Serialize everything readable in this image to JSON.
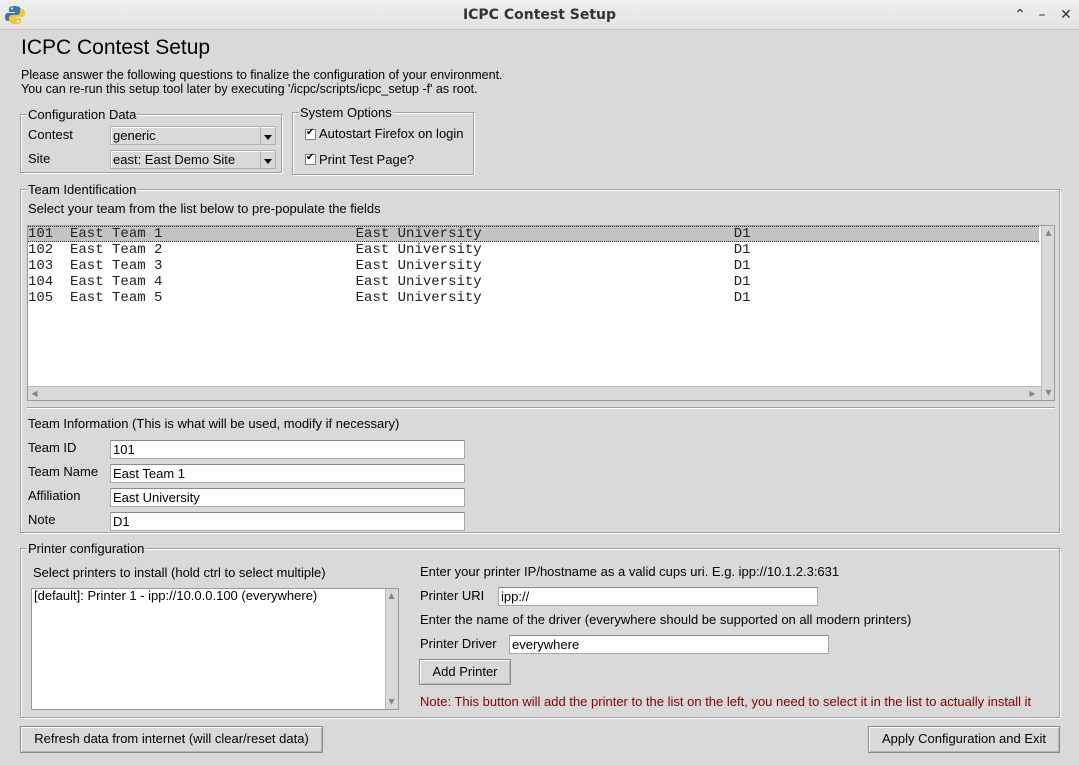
{
  "window": {
    "title": "ICPC Contest Setup",
    "controls": {
      "maximize": "⌃",
      "minimize": "–",
      "close": "✕"
    }
  },
  "heading": "ICPC Contest Setup",
  "intro": {
    "line1": "Please answer the following questions to finalize the configuration of your environment.",
    "line2": "You can re-run this setup tool later by executing '/icpc/scripts/icpc_setup -f' as root."
  },
  "config": {
    "legend": "Configuration Data",
    "contest_label": "Contest",
    "contest_value": "generic",
    "site_label": "Site",
    "site_value": "east: East Demo Site"
  },
  "system": {
    "legend": "System Options",
    "autostart_label": "Autostart Firefox on login",
    "autostart_checked": true,
    "print_test_label": "Print Test Page?",
    "print_test_checked": true
  },
  "team_identification": {
    "legend": "Team Identification",
    "instructions": "Select your team from the list below to pre-populate the fields",
    "selected_index": 0,
    "teams": [
      {
        "id": "101",
        "name": "East Team 1",
        "affiliation": "East University",
        "note": "D1"
      },
      {
        "id": "102",
        "name": "East Team 2",
        "affiliation": "East University",
        "note": "D1"
      },
      {
        "id": "103",
        "name": "East Team 3",
        "affiliation": "East University",
        "note": "D1"
      },
      {
        "id": "104",
        "name": "East Team 4",
        "affiliation": "East University",
        "note": "D1"
      },
      {
        "id": "105",
        "name": "East Team 5",
        "affiliation": "East University",
        "note": "D1"
      }
    ]
  },
  "team_info": {
    "heading": "Team Information (This is what will be used, modify if necessary)",
    "team_id_label": "Team ID",
    "team_id": "101",
    "team_name_label": "Team Name",
    "team_name": "East Team 1",
    "affiliation_label": "Affiliation",
    "affiliation": "East University",
    "note_label": "Note",
    "note": "D1"
  },
  "printer": {
    "legend": "Printer configuration",
    "select_label": "Select printers to install (hold ctrl to select multiple)",
    "printers": [
      "[default]: Printer 1 - ipp://10.0.0.100 (everywhere)"
    ],
    "uri_hint": "Enter your printer IP/hostname as a valid cups uri. E.g. ipp://10.1.2.3:631",
    "uri_label": "Printer URI",
    "uri_value": "ipp://",
    "driver_hint": "Enter the name of the driver (everywhere should be supported on all modern printers)",
    "driver_label": "Printer Driver",
    "driver_value": "everywhere",
    "add_button": "Add Printer",
    "note": "Note: This button will add the printer to the list on the left, you need to select it in the list to actually install it",
    "note_color": "#8b0000"
  },
  "footer": {
    "refresh_button": "Refresh data from internet (will clear/reset data)",
    "apply_button": "Apply Configuration and Exit"
  }
}
